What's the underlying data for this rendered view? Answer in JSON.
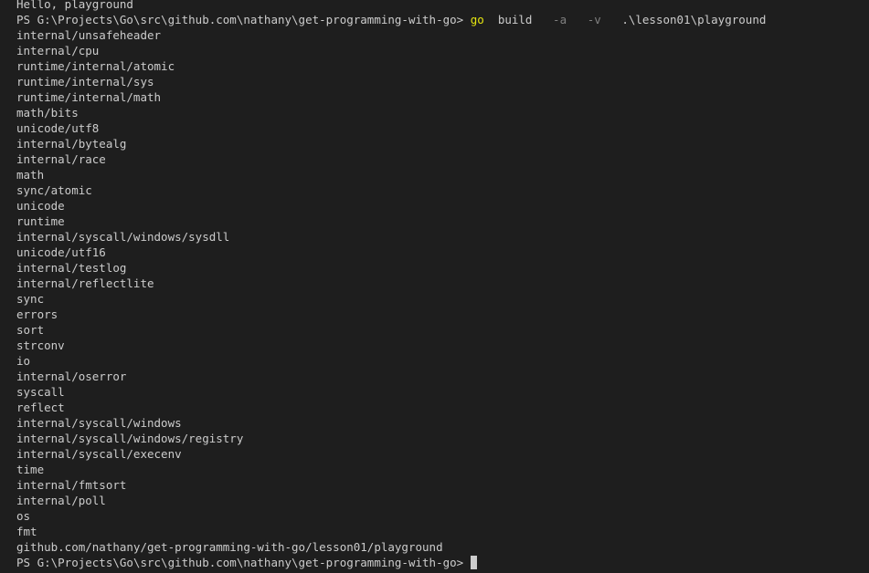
{
  "terminal": {
    "first_output": "Hello, playground",
    "prompt": "PS G:\\Projects\\Go\\src\\github.com\\nathany\\get-programming-with-go> ",
    "command": {
      "exe": "go",
      "sub": "build",
      "flag_a": "-a",
      "flag_v": "-v",
      "path": ".\\lesson01\\playground"
    },
    "packages": [
      "internal/unsafeheader",
      "internal/cpu",
      "runtime/internal/atomic",
      "runtime/internal/sys",
      "runtime/internal/math",
      "math/bits",
      "unicode/utf8",
      "internal/bytealg",
      "internal/race",
      "math",
      "sync/atomic",
      "unicode",
      "runtime",
      "internal/syscall/windows/sysdll",
      "unicode/utf16",
      "internal/testlog",
      "internal/reflectlite",
      "sync",
      "errors",
      "sort",
      "strconv",
      "io",
      "internal/oserror",
      "syscall",
      "reflect",
      "internal/syscall/windows",
      "internal/syscall/windows/registry",
      "internal/syscall/execenv",
      "time",
      "internal/fmtsort",
      "internal/poll",
      "os",
      "fmt",
      "github.com/nathany/get-programming-with-go/lesson01/playground"
    ],
    "final_prompt": "PS G:\\Projects\\Go\\src\\github.com\\nathany\\get-programming-with-go> "
  }
}
